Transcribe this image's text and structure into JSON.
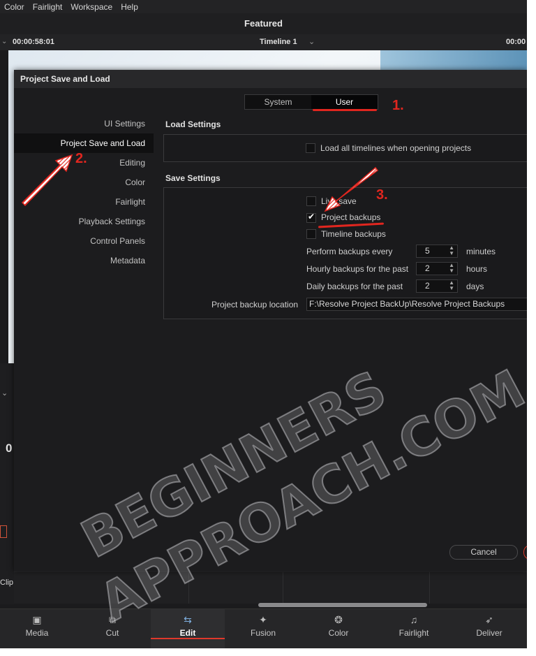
{
  "menu": [
    "Color",
    "Fairlight",
    "Workspace",
    "Help"
  ],
  "title": "Featured",
  "viewer": {
    "timecode_left": "00:00:58:01",
    "timeline_name": "Timeline 1",
    "timecode_right": "00:00"
  },
  "left_remnants": {
    "big_digit": "0",
    "clip_label": "Clip"
  },
  "dialog": {
    "title": "Project Save and Load",
    "tabs": {
      "system": "System",
      "user": "User"
    },
    "nav": [
      {
        "label": "UI Settings"
      },
      {
        "label": "Project Save and Load"
      },
      {
        "label": "Editing"
      },
      {
        "label": "Color"
      },
      {
        "label": "Fairlight"
      },
      {
        "label": "Playback Settings"
      },
      {
        "label": "Control Panels"
      },
      {
        "label": "Metadata"
      }
    ],
    "load_settings": {
      "title": "Load Settings",
      "load_all_timelines": {
        "label": "Load all timelines when opening projects",
        "checked": false
      }
    },
    "save_settings": {
      "title": "Save Settings",
      "live_save": {
        "label": "Live save",
        "checked": false
      },
      "project_backups": {
        "label": "Project backups",
        "checked": true
      },
      "timeline_backups": {
        "label": "Timeline backups",
        "checked": false
      },
      "perform_every": {
        "label": "Perform backups every",
        "value": "5",
        "unit": "minutes"
      },
      "hourly": {
        "label": "Hourly backups for the past",
        "value": "2",
        "unit": "hours"
      },
      "daily": {
        "label": "Daily backups for the past",
        "value": "2",
        "unit": "days"
      },
      "location": {
        "label": "Project backup location",
        "value": "F:\\Resolve Project BackUp\\Resolve Project Backups"
      }
    },
    "cancel_label": "Cancel"
  },
  "annotations": {
    "step1": "1.",
    "step2": "2.",
    "step3": "3.",
    "accent_color": "#e0261f"
  },
  "watermark": {
    "line1": "BEGINNERS",
    "line2": "APPROACH.COM"
  },
  "pages": [
    {
      "label": "Media",
      "icon": "media-icon"
    },
    {
      "label": "Cut",
      "icon": "cut-icon"
    },
    {
      "label": "Edit",
      "icon": "edit-icon",
      "active": true
    },
    {
      "label": "Fusion",
      "icon": "fusion-icon"
    },
    {
      "label": "Color",
      "icon": "color-icon"
    },
    {
      "label": "Fairlight",
      "icon": "fairlight-icon"
    },
    {
      "label": "Deliver",
      "icon": "deliver-icon"
    }
  ]
}
